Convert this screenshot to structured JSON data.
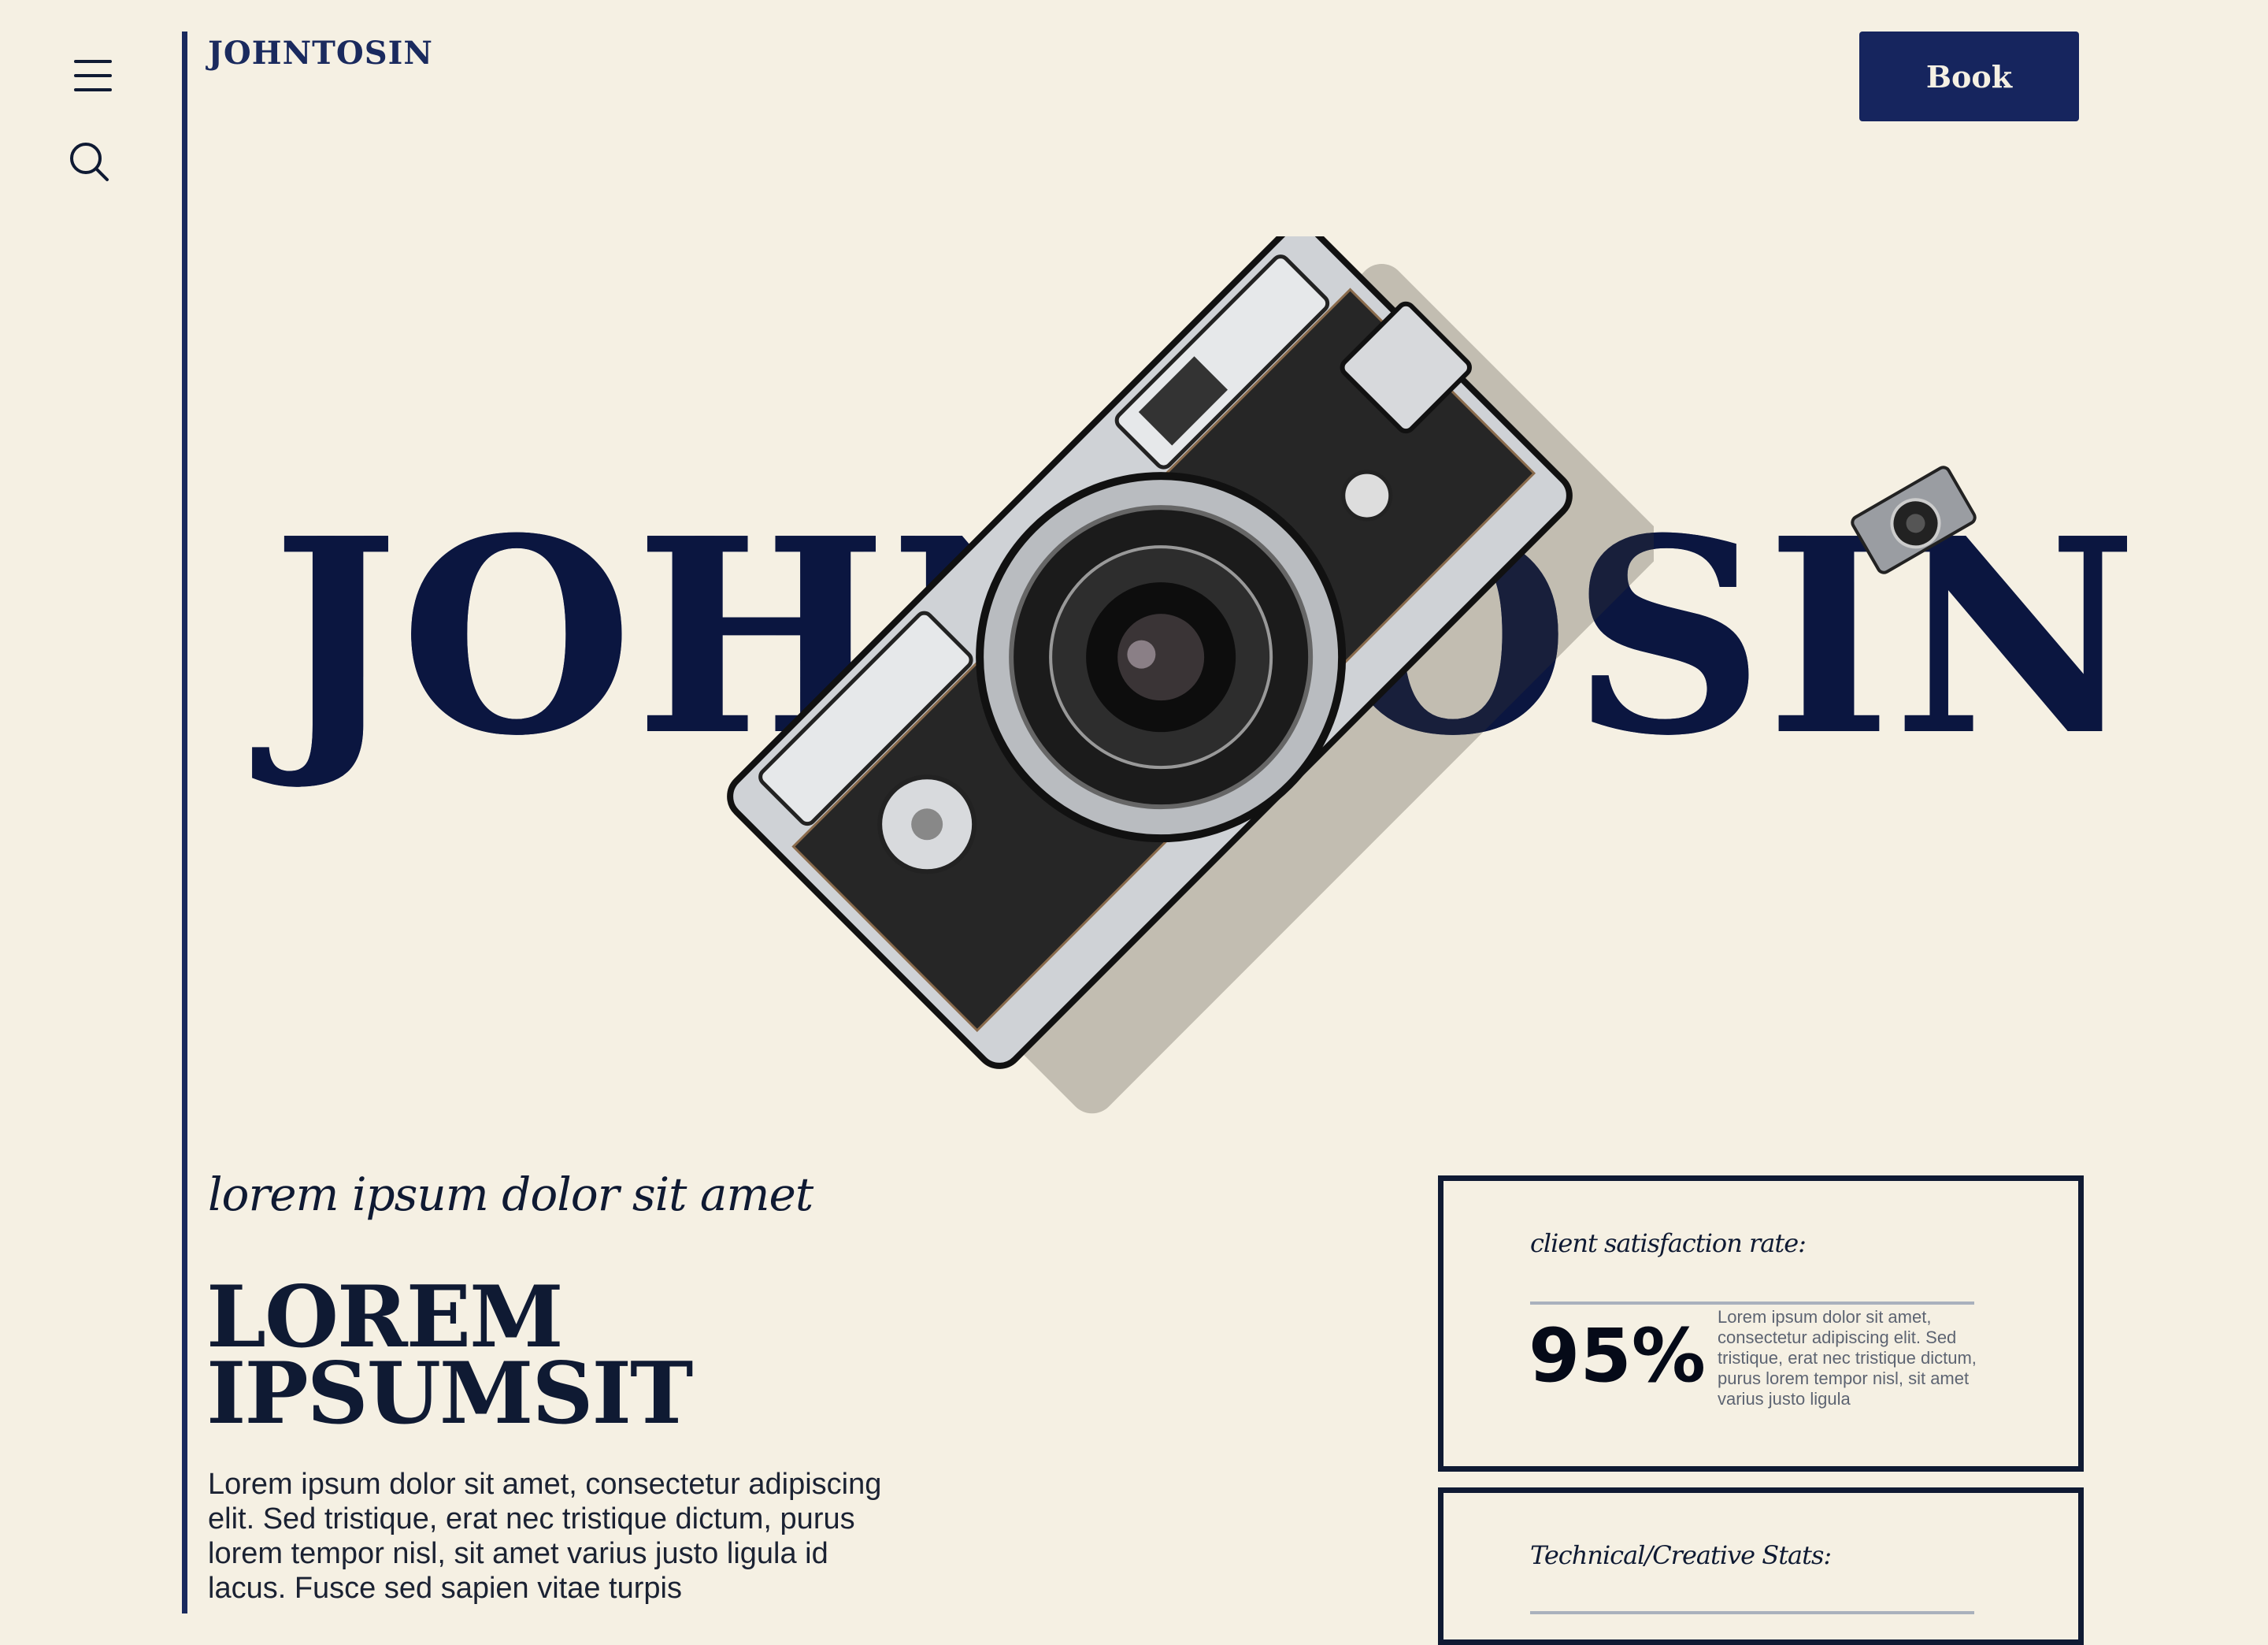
{
  "nav": {
    "menu_icon": "hamburger-menu-icon",
    "search_icon": "search-icon",
    "brand": "JOHNTOSIN",
    "book_label": "Book"
  },
  "hero": {
    "title": "JOHNTOSIN",
    "camera_image": "vintage-camera-illustration",
    "mini_camera_image": "small-camera-illustration"
  },
  "intro": {
    "tagline": "lorem ipsum dolor sit amet",
    "headline_line1": "LOREM",
    "headline_line2": "IPSUMSIT",
    "body": "Lorem ipsum dolor sit amet, consectetur adipiscing elit. Sed tristique, erat nec tristique dictum, purus lorem tempor nisl, sit amet varius justo ligula id lacus. Fusce sed sapien vitae turpis"
  },
  "stats": [
    {
      "label": "client satisfaction rate:",
      "value": "95%",
      "description": "Lorem ipsum dolor sit amet, consectetur adipiscing elit. Sed tristique, erat nec tristique dictum, purus lorem tempor nisl, sit amet varius justo ligula"
    },
    {
      "label": "Technical/Creative Stats:"
    }
  ],
  "colors": {
    "background": "#f5f0e3",
    "navy": "#16255e",
    "ink": "#0f1a33"
  }
}
